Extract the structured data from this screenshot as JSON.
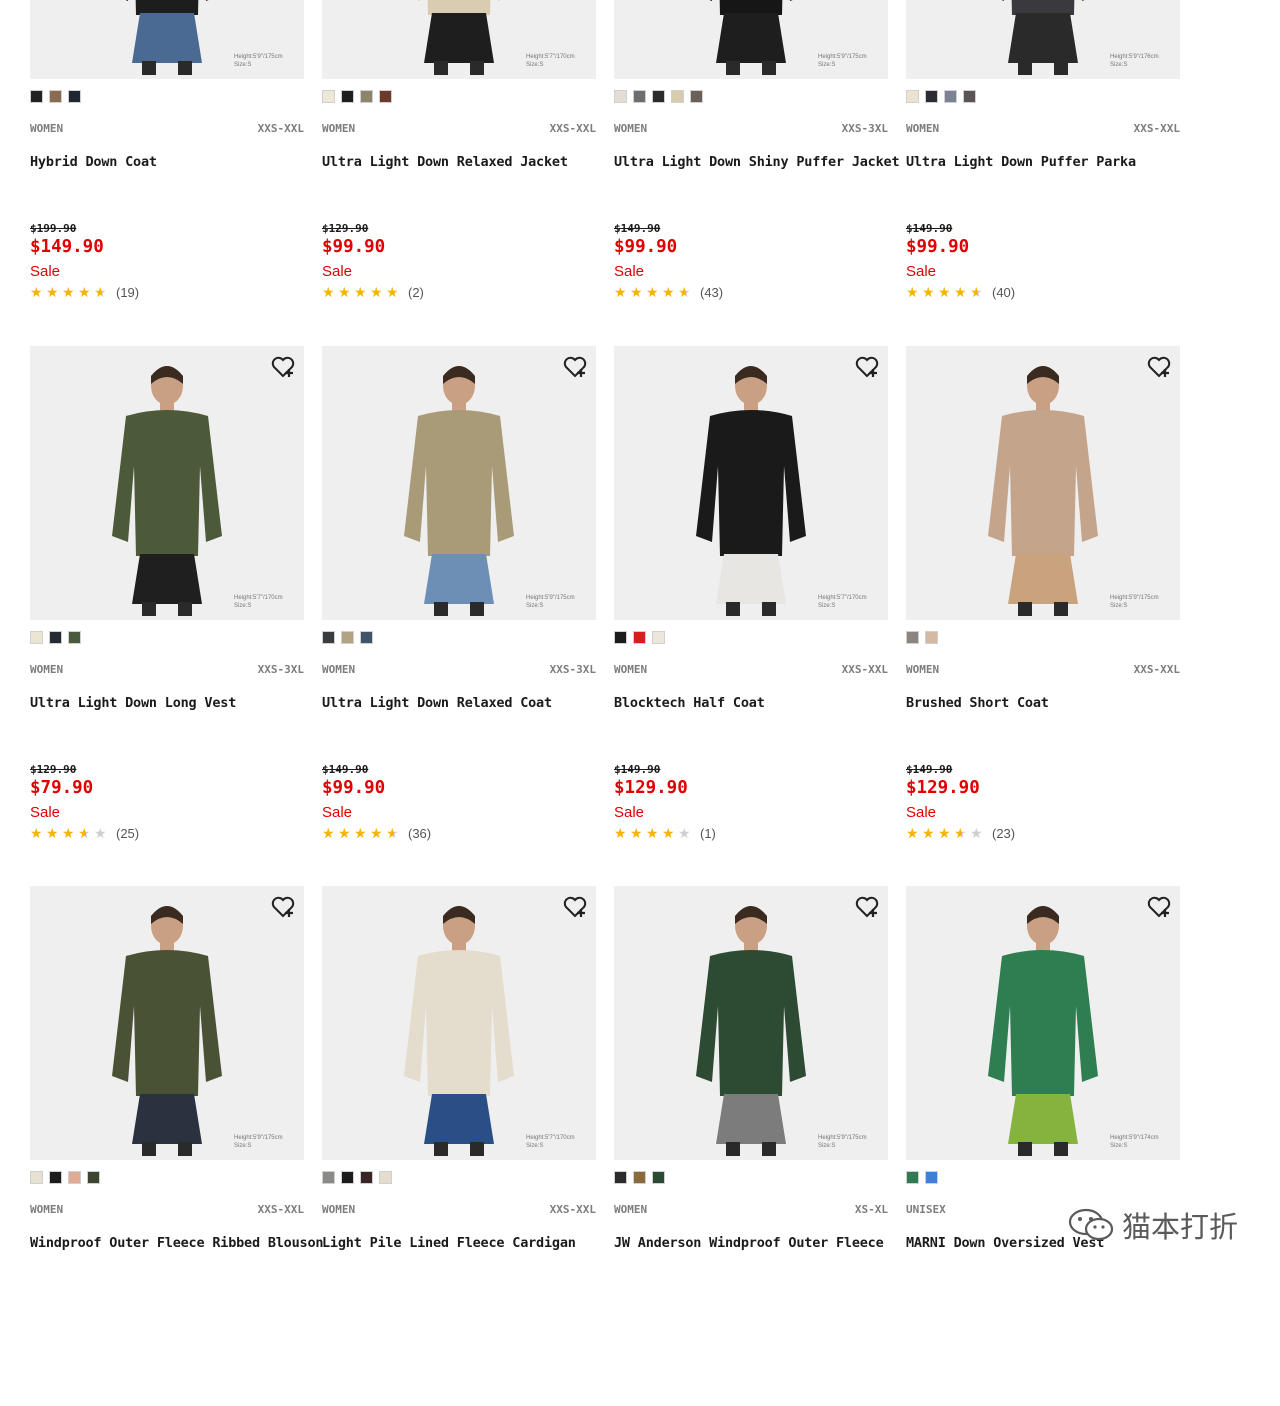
{
  "colors": {
    "sale_red": "#e00000",
    "star_gold": "#f5b400"
  },
  "products": [
    {
      "gender": "WOMEN",
      "size": "XXS-XXL",
      "name": "Hybrid Down Coat",
      "orig": "$199.90",
      "price": "$149.90",
      "sale": "Sale",
      "rating": 4.5,
      "reviews": "(19)",
      "swatches": [
        "#222222",
        "#8b6b50",
        "#1e2633"
      ],
      "model_note": "Height:5'9\"/175cm Size:S"
    },
    {
      "gender": "WOMEN",
      "size": "XXS-XXL",
      "name": "Ultra Light Down Relaxed Jacket",
      "orig": "$129.90",
      "price": "$99.90",
      "sale": "Sale",
      "rating": 5,
      "reviews": "(2)",
      "swatches": [
        "#efe8d6",
        "#1f1f1f",
        "#8c8569",
        "#6b3a2c"
      ],
      "model_note": "Height:5'7\"/170cm Size:S"
    },
    {
      "gender": "WOMEN",
      "size": "XXS-3XL",
      "name": "Ultra Light Down Shiny Puffer Jacket",
      "orig": "$149.90",
      "price": "$99.90",
      "sale": "Sale",
      "rating": 4.5,
      "reviews": "(43)",
      "swatches": [
        "#e4ddd4",
        "#6e6e6e",
        "#2b2b2b",
        "#d7ccb0",
        "#6b6058"
      ],
      "model_note": "Height:5'9\"/175cm Size:S"
    },
    {
      "gender": "WOMEN",
      "size": "XXS-XXL",
      "name": "Ultra Light Down Puffer Parka",
      "orig": "$149.90",
      "price": "$99.90",
      "sale": "Sale",
      "rating": 4.5,
      "reviews": "(40)",
      "swatches": [
        "#ece2d4",
        "#2b2e33",
        "#7a8294",
        "#5a5357"
      ],
      "model_note": "Height:5'9\"/176cm Size:S"
    },
    {
      "gender": "WOMEN",
      "size": "XXS-3XL",
      "name": "Ultra Light Down Long Vest",
      "orig": "$129.90",
      "price": "$79.90",
      "sale": "Sale",
      "rating": 3.5,
      "reviews": "(25)",
      "swatches": [
        "#ebe6d4",
        "#252a33",
        "#4a5a3c"
      ],
      "model_note": "Height:5'7\"/170cm Size:S"
    },
    {
      "gender": "WOMEN",
      "size": "XXS-3XL",
      "name": "Ultra Light Down Relaxed Coat",
      "orig": "$149.90",
      "price": "$99.90",
      "sale": "Sale",
      "rating": 4.5,
      "reviews": "(36)",
      "swatches": [
        "#3a3c40",
        "#b3a383",
        "#3f5468"
      ],
      "model_note": "Height:5'9\"/175cm Size:S"
    },
    {
      "gender": "WOMEN",
      "size": "XXS-XXL",
      "name": "Blocktech Half Coat",
      "orig": "$149.90",
      "price": "$129.90",
      "sale": "Sale",
      "rating": 4,
      "reviews": "(1)",
      "swatches": [
        "#1c1c1c",
        "#d42020",
        "#ece6dc"
      ],
      "model_note": "Height:5'7\"/170cm Size:S"
    },
    {
      "gender": "WOMEN",
      "size": "XXS-XXL",
      "name": "Brushed Short Coat",
      "orig": "$149.90",
      "price": "$129.90",
      "sale": "Sale",
      "rating": 3.5,
      "reviews": "(23)",
      "swatches": [
        "#8a8580",
        "#d6b9a3"
      ],
      "model_note": "Height:5'9\"/175cm Size:S"
    },
    {
      "gender": "WOMEN",
      "size": "XXS-XXL",
      "name": "Windproof Outer Fleece Ribbed Blouson",
      "orig": "",
      "price": "",
      "sale": "",
      "rating": 0,
      "reviews": "",
      "swatches": [
        "#e7e1d2",
        "#1c1c1c",
        "#e0ab94",
        "#3c4530"
      ],
      "model_note": "Height:5'9\"/175cm Size:S"
    },
    {
      "gender": "WOMEN",
      "size": "XXS-XXL",
      "name": "Light Pile Lined Fleece Cardigan",
      "orig": "",
      "price": "",
      "sale": "",
      "rating": 0,
      "reviews": "",
      "swatches": [
        "#8a8a86",
        "#1c1c1c",
        "#3a2526",
        "#e6dccb"
      ],
      "model_note": "Height:5'7\"/170cm Size:S"
    },
    {
      "gender": "WOMEN",
      "size": "XS-XL",
      "name": "JW Anderson Windproof Outer Fleece",
      "orig": "",
      "price": "",
      "sale": "",
      "rating": 0,
      "reviews": "",
      "swatches": [
        "#2b2b2b",
        "#8a6a3a",
        "#2a4a36"
      ],
      "model_note": "Height:5'9\"/175cm Size:S"
    },
    {
      "gender": "UNISEX",
      "size": "",
      "name": "MARNI Down Oversized Vest",
      "orig": "",
      "price": "",
      "sale": "",
      "rating": 0,
      "reviews": "",
      "swatches": [
        "#2f7a55",
        "#3f7fd8"
      ],
      "model_note": "Height:5'9\"/174cm Size:S"
    }
  ],
  "watermark": {
    "text": "猫本打折",
    "icon": "wechat-icon"
  }
}
